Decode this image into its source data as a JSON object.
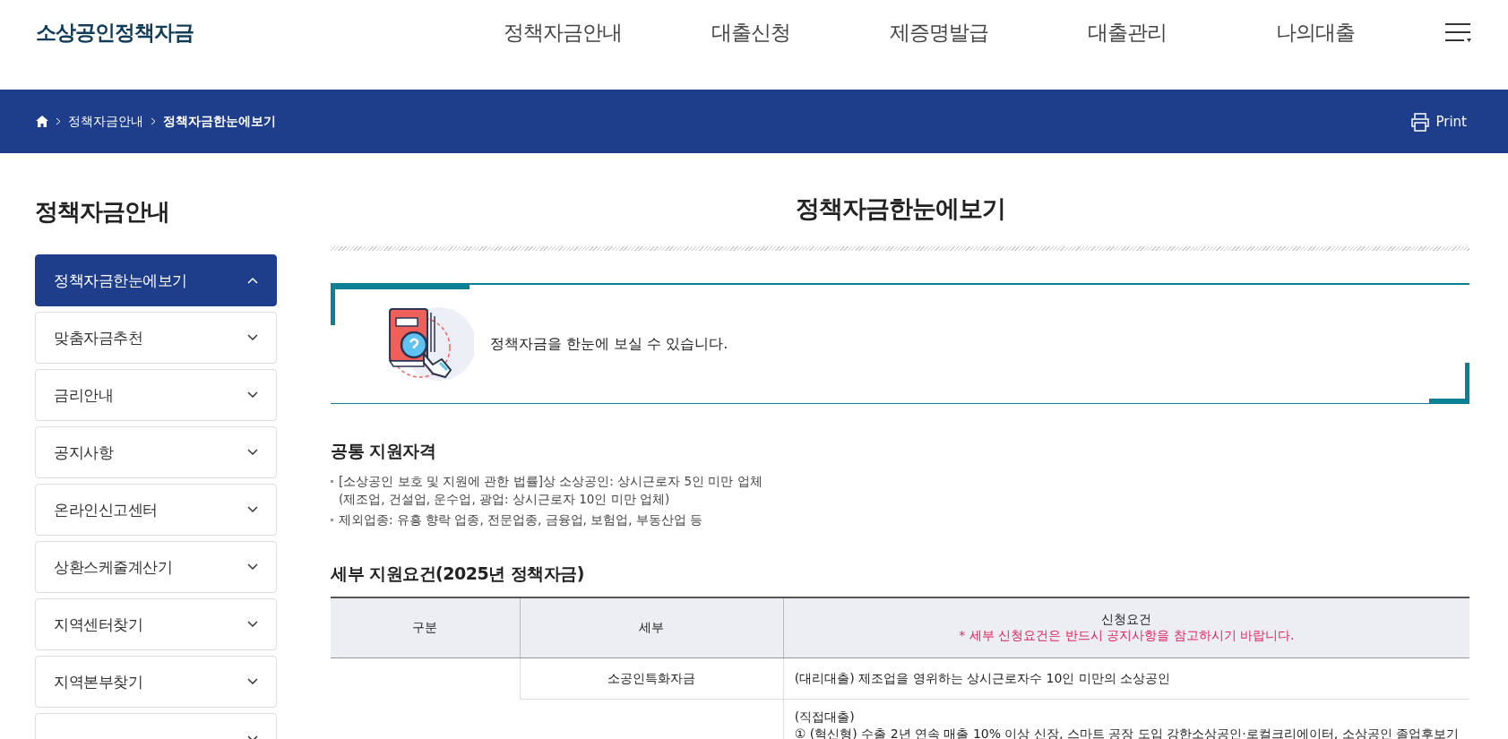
{
  "header": {
    "logo": "소상공인정책자금",
    "nav": [
      "정책자금안내",
      "대출신청",
      "제증명발급",
      "대출관리",
      "나의대출"
    ]
  },
  "breadcrumb": {
    "items": [
      "정책자금안내",
      "정책자금한눈에보기"
    ],
    "print": "Print"
  },
  "sidebar": {
    "title": "정책자금안내",
    "items": [
      {
        "label": "정책자금한눈에보기",
        "selected": true
      },
      {
        "label": "맞춤자금추천",
        "selected": false
      },
      {
        "label": "금리안내",
        "selected": false
      },
      {
        "label": "공지사항",
        "selected": false
      },
      {
        "label": "온라인신고센터",
        "selected": false
      },
      {
        "label": "상환스케줄계산기",
        "selected": false
      },
      {
        "label": "지역센터찾기",
        "selected": false
      },
      {
        "label": "지역본부찾기",
        "selected": false
      },
      {
        "selected": false
      }
    ]
  },
  "content": {
    "title": "정책자금한눈에보기",
    "intro": "정책자금을 한눈에 보실 수 있습니다.",
    "common": {
      "heading": "공통 지원자격",
      "bullets": [
        [
          "[소상공인 보호 및 지원에 관한 법률]상 소상공인: 상시근로자 5인 미만 업체",
          "(제조업, 건설업, 운수업, 광업: 상시근로자 10인 미만 업체)"
        ],
        [
          "제외업종: 유흥 향락 업종, 전문업종, 금융업, 보험업, 부동산업 등"
        ]
      ]
    },
    "detail": {
      "heading": "세부 지원요건(2025년 정책자금)",
      "columns": [
        "구분",
        "세부",
        "신청요건"
      ],
      "note": "* 세부 신청요건은 반드시 공지사항을 참고하시기 바랍니다.",
      "rows": [
        {
          "detail": "소공인특화자금",
          "requirement": [
            "(대리대출) 제조업을 영위하는 상시근로자수 10인 미만의 소상공인"
          ]
        },
        {
          "requirement": [
            "(직접대출)",
            "① (혁신형) 수출 2년 연속 매출 10% 이상 신장, 스마트 공장 도입 강한소상공인·로컬크리에이터, 소상공인 졸업후보기"
          ]
        }
      ]
    }
  }
}
